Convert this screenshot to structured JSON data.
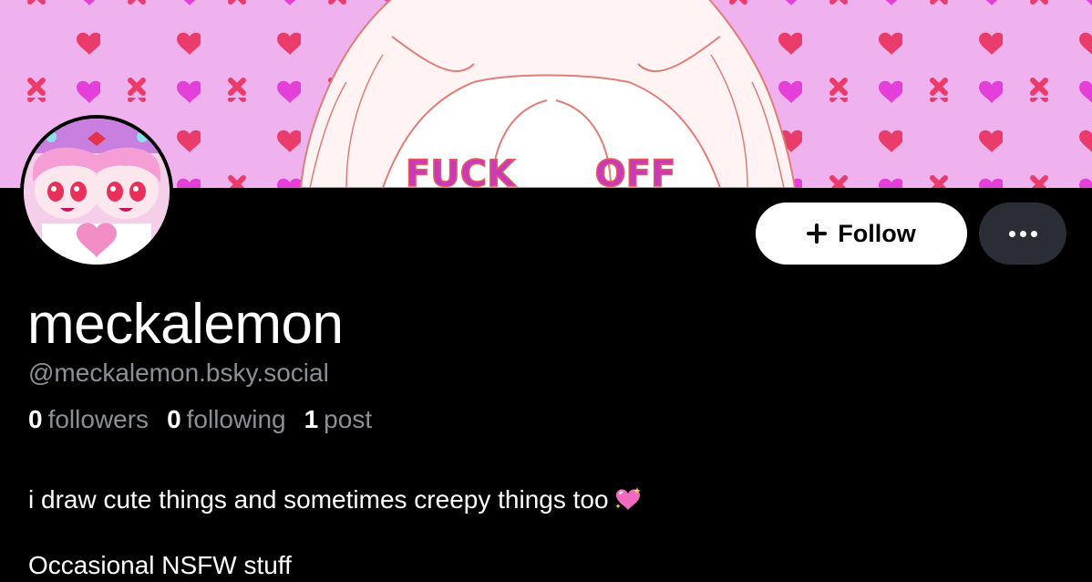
{
  "profile": {
    "display_name": "meckalemon",
    "handle": "@meckalemon.bsky.social",
    "bio_line1": "i draw cute things and sometimes creepy things too",
    "bio_emoji": "sparkling-heart-icon",
    "bio_line2": "Occasional NSFW stuff"
  },
  "stats": {
    "followers_count": "0",
    "followers_label": "followers",
    "following_count": "0",
    "following_label": "following",
    "posts_count": "1",
    "posts_label": "post"
  },
  "actions": {
    "follow_label": "Follow",
    "follow_icon": "plus-icon",
    "more_icon": "ellipsis-icon"
  },
  "banner": {
    "text_left": "FUCK",
    "text_right": "OFF"
  },
  "colors": {
    "background": "#000000",
    "banner_pink": "#f0b2ef",
    "heart_magenta": "#e43fd8",
    "cross_red": "#ea3c6b",
    "muted_text": "#8b8f96",
    "more_button_bg": "#2a2d33"
  }
}
